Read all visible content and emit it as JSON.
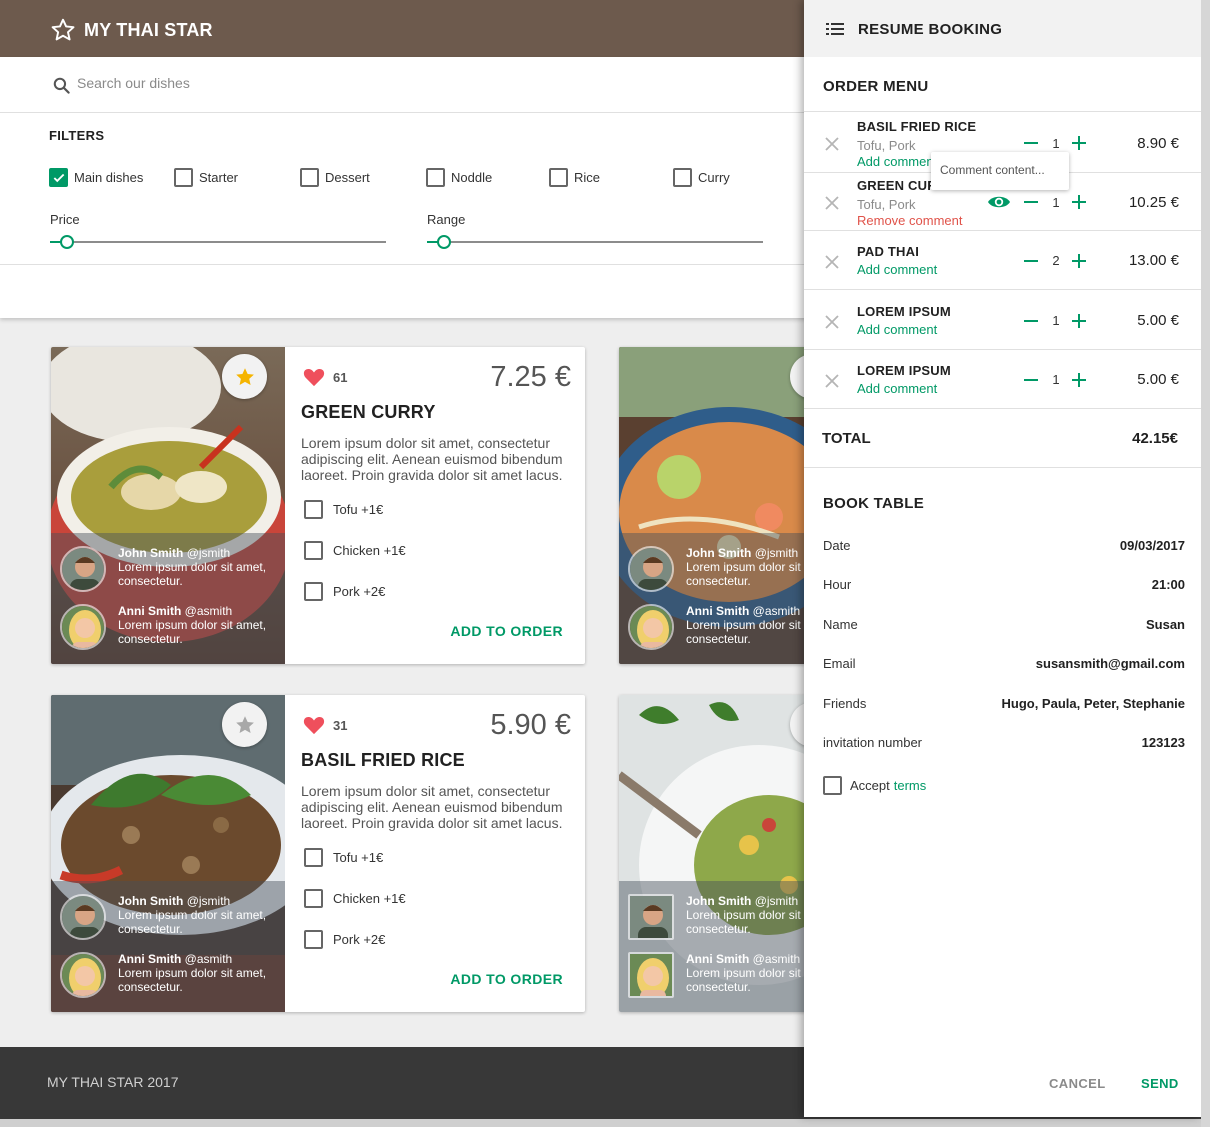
{
  "header": {
    "brand": "MY THAI STAR",
    "brand_color": "#6d5a4d",
    "logo_icon": "star-outline-icon"
  },
  "search": {
    "placeholder": "Search our dishes",
    "value": ""
  },
  "filters": {
    "title": "FILTERS",
    "categories": [
      {
        "label": "Main dishes",
        "checked": true
      },
      {
        "label": "Starter",
        "checked": false
      },
      {
        "label": "Dessert",
        "checked": false
      },
      {
        "label": "Noddle",
        "checked": false
      },
      {
        "label": "Rice",
        "checked": false
      },
      {
        "label": "Curry",
        "checked": false
      }
    ],
    "price_label": "Price",
    "price_value": 0.05,
    "range_label": "Range",
    "range_value": 0.05
  },
  "accent_color": "#009966",
  "dishes": [
    {
      "name": "GREEN CURRY",
      "price": "7.25 €",
      "likes": "61",
      "favorite": true,
      "description": "Lorem ipsum dolor sit amet, consectetur adipiscing elit. Aenean euismod bibendum laoreet. Proin gravida dolor sit amet lacus.",
      "ingredients": [
        "Tofu +1€",
        "Chicken +1€",
        "Pork +2€"
      ],
      "add_label": "ADD TO ORDER",
      "comments": [
        {
          "name": "John Smith",
          "handle": "@jsmith",
          "text": "Lorem ipsum dolor sit amet, consectetur."
        },
        {
          "name": "Anni Smith",
          "handle": "@asmith",
          "text": "Lorem ipsum dolor sit amet, consectetur."
        }
      ]
    },
    {
      "name": "BASIL FRIED RICE",
      "price": "5.90 €",
      "likes": "31",
      "favorite": false,
      "description": "Lorem ipsum dolor sit amet, consectetur adipiscing elit. Aenean euismod bibendum laoreet. Proin gravida dolor sit amet lacus.",
      "ingredients": [
        "Tofu +1€",
        "Chicken +1€",
        "Pork +2€"
      ],
      "add_label": "ADD TO ORDER",
      "comments": [
        {
          "name": "John Smith",
          "handle": "@jsmith",
          "text": "Lorem ipsum dolor sit amet, consectetur."
        },
        {
          "name": "Anni Smith",
          "handle": "@asmith",
          "text": "Lorem ipsum dolor sit amet, consectetur."
        }
      ]
    },
    {
      "comments": [
        {
          "name": "John Smith",
          "handle": "@jsmith",
          "text": "Lorem ipsum dolor sit amet, consectetur."
        },
        {
          "name": "Anni Smith",
          "handle": "@asmith",
          "text": "Lorem ipsum dolor sit amet, consectetur."
        }
      ]
    },
    {
      "comments": [
        {
          "name": "John Smith",
          "handle": "@jsmith",
          "text": "Lorem ipsum dolor sit amet, consectetur."
        },
        {
          "name": "Anni Smith",
          "handle": "@asmith",
          "text": "Lorem ipsum dolor sit amet, consectetur."
        }
      ]
    }
  ],
  "footer": {
    "text": "MY THAI STAR 2017"
  },
  "drawer": {
    "title": "RESUME BOOKING",
    "order_title": "ORDER MENU",
    "items": [
      {
        "name": "BASIL FRIED RICE",
        "options": "Tofu, Pork",
        "link": "Add comment",
        "qty": "1",
        "price": "8.90 €"
      },
      {
        "name": "GREEN CURRY",
        "options": "Tofu, Pork",
        "link": "Remove comment",
        "qty": "1",
        "price": "10.25 €"
      },
      {
        "name": "PAD THAI",
        "link": "Add comment",
        "qty": "2",
        "price": "13.00 €"
      },
      {
        "name": "LOREM IPSUM",
        "link": "Add comment",
        "qty": "1",
        "price": "5.00 €"
      },
      {
        "name": "LOREM IPSUM",
        "link": "Add comment",
        "qty": "1",
        "price": "5.00 €"
      }
    ],
    "tooltip": "Comment content...",
    "total_label": "TOTAL",
    "total_value": "42.15€",
    "book_title": "BOOK TABLE",
    "booking": [
      {
        "label": "Date",
        "value": "09/03/2017"
      },
      {
        "label": "Hour",
        "value": "21:00"
      },
      {
        "label": "Name",
        "value": "Susan"
      },
      {
        "label": "Email",
        "value": "susansmith@gmail.com"
      },
      {
        "label": "Friends",
        "value": "Hugo, Paula, Peter, Stephanie"
      },
      {
        "label": "invitation number",
        "value": "123123"
      }
    ],
    "accept_label": "Accept",
    "terms_label": "terms",
    "cancel_label": "CANCEL",
    "send_label": "SEND"
  }
}
